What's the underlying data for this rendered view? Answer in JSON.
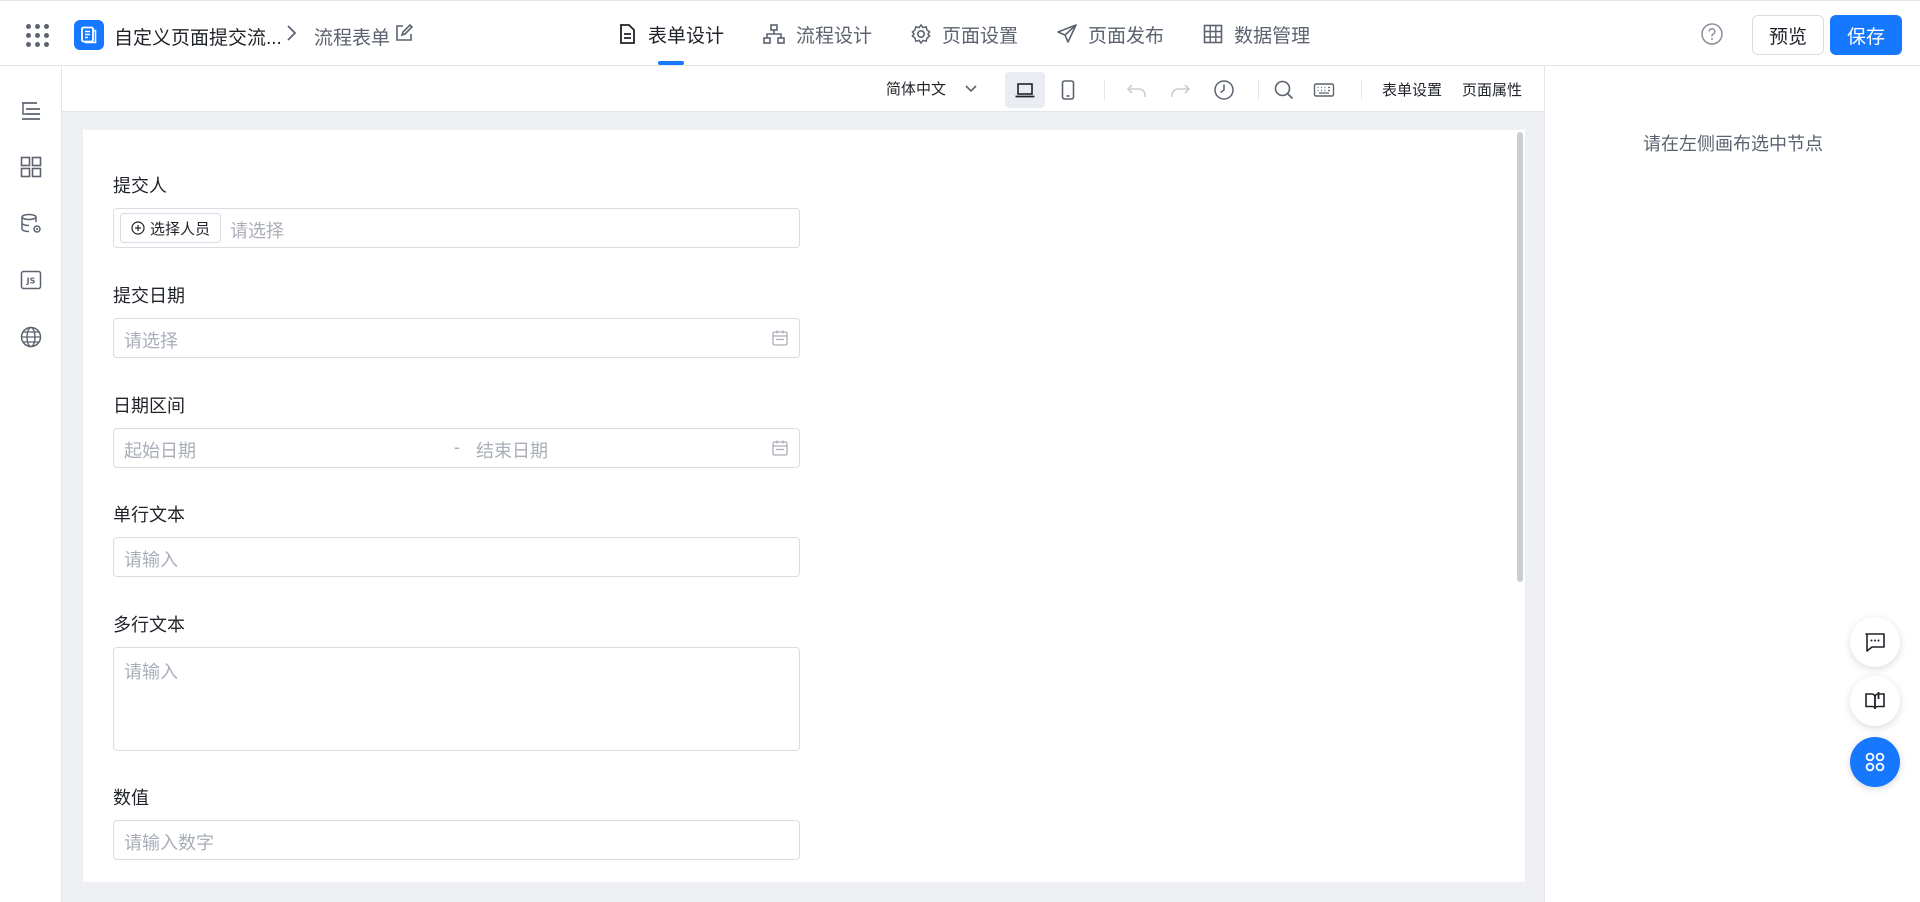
{
  "header": {
    "app_title": "自定义页面提交流...",
    "page_name": "流程表单",
    "tabs": [
      {
        "label": "表单设计",
        "icon": "document-icon",
        "active": true
      },
      {
        "label": "流程设计",
        "icon": "flow-chart-icon",
        "active": false
      },
      {
        "label": "页面设置",
        "icon": "gear-icon",
        "active": false
      },
      {
        "label": "页面发布",
        "icon": "send-icon",
        "active": false
      },
      {
        "label": "数据管理",
        "icon": "table-icon",
        "active": false
      }
    ],
    "preview_label": "预览",
    "save_label": "保存",
    "accent_color": "#1677ff"
  },
  "sidebar": {
    "items": [
      {
        "icon": "outline-tree-icon"
      },
      {
        "icon": "components-grid-icon"
      },
      {
        "icon": "data-source-icon"
      },
      {
        "icon": "js-code-icon"
      },
      {
        "icon": "globe-icon"
      }
    ]
  },
  "toolbar": {
    "language": "简体中文",
    "form_settings": "表单设置",
    "page_properties": "页面属性"
  },
  "form": {
    "fields": {
      "submitter": {
        "label": "提交人",
        "button": "选择人员",
        "placeholder": "请选择"
      },
      "submit_date": {
        "label": "提交日期",
        "placeholder": "请选择"
      },
      "date_range": {
        "label": "日期区间",
        "start_placeholder": "起始日期",
        "separator": "-",
        "end_placeholder": "结束日期"
      },
      "single_text": {
        "label": "单行文本",
        "placeholder": "请输入"
      },
      "multi_text": {
        "label": "多行文本",
        "placeholder": "请输入"
      },
      "number": {
        "label": "数值",
        "placeholder": "请输入数字"
      }
    }
  },
  "right_panel": {
    "hint": "请在左侧画布选中节点"
  }
}
